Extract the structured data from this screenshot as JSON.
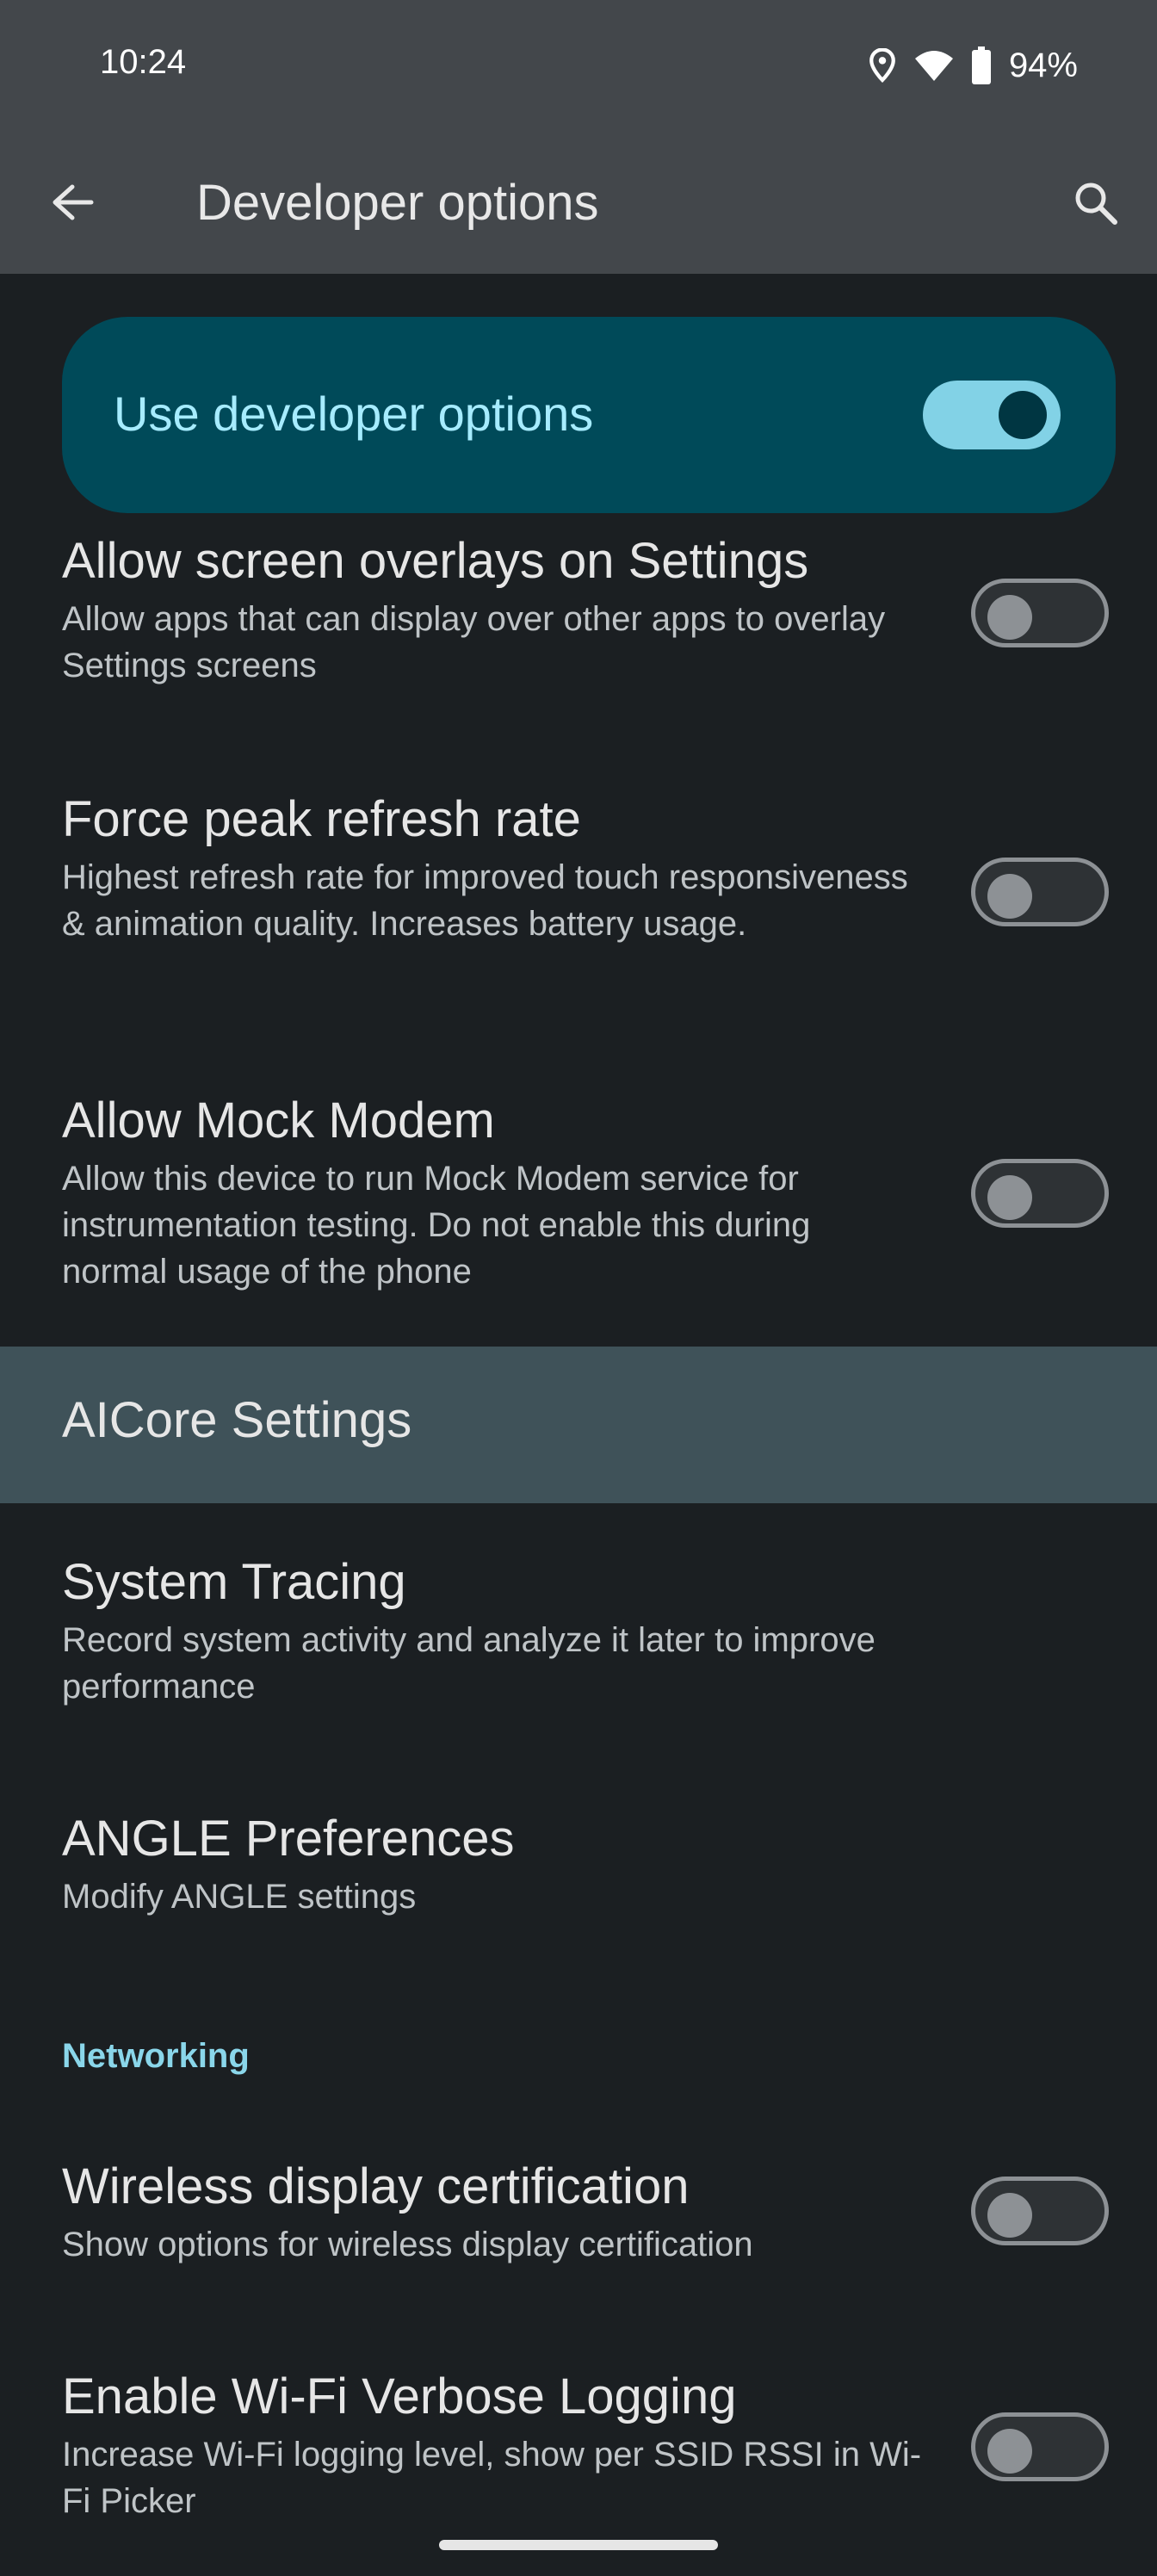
{
  "status_bar": {
    "time": "10:24",
    "battery": "94%",
    "icons": [
      "location-icon",
      "wifi-icon",
      "battery-icon"
    ]
  },
  "app_bar": {
    "title": "Developer options",
    "back_icon": "arrow-left-icon",
    "search_icon": "search-icon"
  },
  "main_switch": {
    "label": "Use developer options",
    "checked": true
  },
  "items": [
    {
      "title": "Allow screen overlays on Settings",
      "subtitle": "Allow apps that can display over other apps to overlay Settings screens",
      "checked": false
    },
    {
      "title": "Force peak refresh rate",
      "subtitle": "Highest refresh rate for improved touch responsiveness & animation quality. Increases battery usage.",
      "checked": false
    },
    {
      "title": "Allow Mock Modem",
      "subtitle": "Allow this device to run Mock Modem service for instrumentation testing. Do not enable this during normal usage of the phone",
      "checked": false
    },
    {
      "title": "AICore Settings"
    },
    {
      "title": "System Tracing",
      "subtitle": "Record system activity and analyze it later to improve performance"
    },
    {
      "title": "ANGLE Preferences",
      "subtitle": "Modify ANGLE settings"
    },
    {
      "title": "Wireless display certification",
      "subtitle": "Show options for wireless display certification",
      "checked": false
    },
    {
      "title": "Enable Wi-Fi Verbose Logging",
      "subtitle": "Increase Wi-Fi logging level, show per SSID RSSI in Wi-Fi Picker",
      "checked": false
    }
  ],
  "sections": {
    "networking": "Networking"
  },
  "colors": {
    "accent": "#8ad6ea",
    "main_switch_bg": "#004a59",
    "highlight_bg": "#3f5259",
    "background": "#1b1f22"
  }
}
